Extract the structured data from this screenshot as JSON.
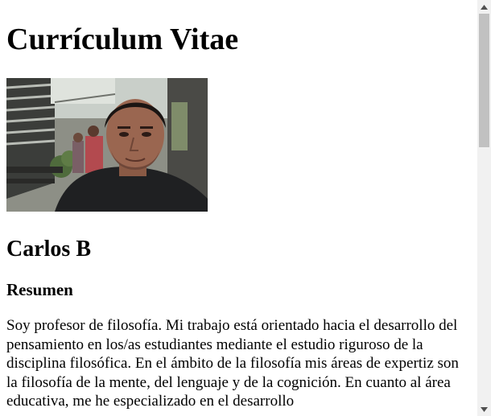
{
  "page": {
    "title": "Currículum Vitae",
    "photo_icon": "profile-photo",
    "name": "Carlos B",
    "summary_heading": "Resumen",
    "summary_text": "Soy profesor de filosofía. Mi trabajo está orientado hacia el desarrollo del pensamiento en los/as estudiantes mediante el estudio riguroso de la disciplina filosófica. En el ámbito de la filosofía mis áreas de expertiz son la filosofía de la mente, del lenguaje y de la cognición. En cuanto al área educativa, me he especializado en el desarrollo"
  },
  "scrollbar": {
    "up_icon": "scroll-up-arrow-icon",
    "down_icon": "scroll-down-arrow-icon"
  }
}
